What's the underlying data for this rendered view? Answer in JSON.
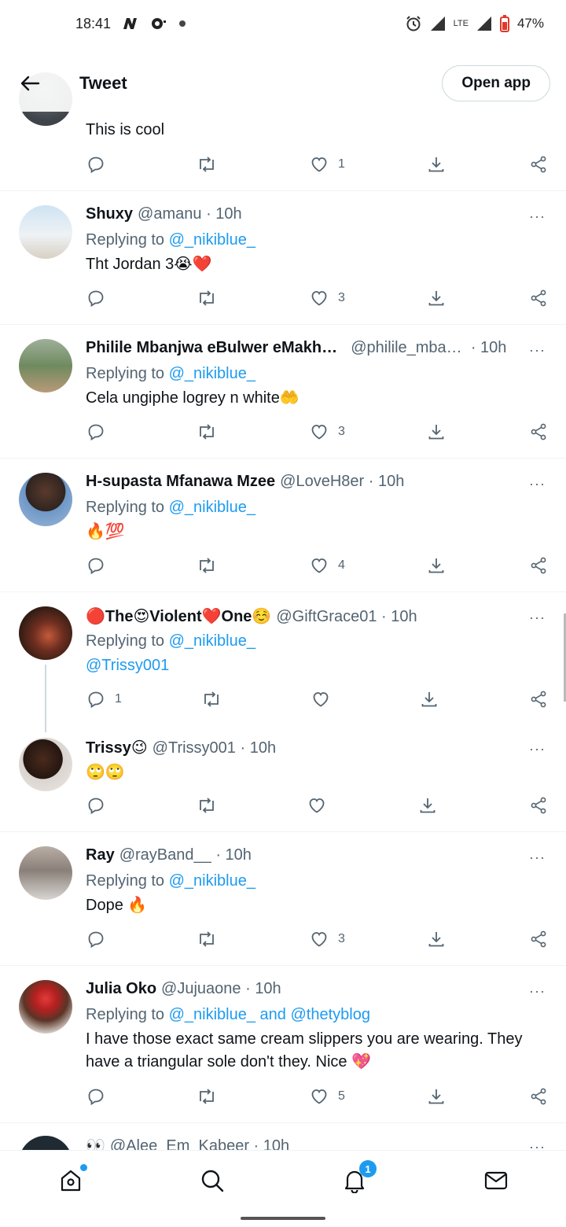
{
  "status": {
    "time": "18:41",
    "battery": "47%",
    "network": "LTE"
  },
  "header": {
    "title": "Tweet",
    "open_app": "Open app"
  },
  "tweets": [
    {
      "text": "This is cool",
      "likes": "1"
    },
    {
      "name": "Shuxy",
      "handle": "@amanu",
      "dot": "·",
      "time": "10h",
      "replying": "Replying to",
      "mention": "@_nikiblue_",
      "text": "Tht Jordan 3😭❤️",
      "likes": "3"
    },
    {
      "name": "Philile Mbanjwa eBulwer eMakh…",
      "handle": "@philile_mba…",
      "dot": "·",
      "time": "10h",
      "replying": "Replying to",
      "mention": "@_nikiblue_",
      "text": "Cela ungiphe logrey n white🤲",
      "likes": "3"
    },
    {
      "name": "H-supasta Mfanawa Mzee",
      "handle": "@LoveH8er",
      "dot": "·",
      "time": "10h",
      "replying": "Replying to",
      "mention": "@_nikiblue_",
      "text": "🔥💯",
      "likes": "4"
    },
    {
      "name": "🔴The😍Violent❤️One☺️",
      "handle": "@GiftGrace01",
      "dot": "·",
      "time": "10h",
      "replying": "Replying to",
      "mention": "@_nikiblue_",
      "text": "@Trissy001",
      "replies": "1"
    },
    {
      "name": "Trissy😉",
      "handle": "@Trissy001",
      "dot": "·",
      "time": "10h",
      "text": "🙄🙄"
    },
    {
      "name": "Ray",
      "handle": "@rayBand__",
      "dot": "·",
      "time": "10h",
      "replying": "Replying to",
      "mention": "@_nikiblue_",
      "text": "Dope 🔥",
      "likes": "3"
    },
    {
      "name": "Julia Oko",
      "handle": "@Jujuaone",
      "dot": "·",
      "time": "10h",
      "replying": "Replying to",
      "mention": "@_nikiblue_ and @thetyblog",
      "text": "I have those exact same cream slippers you are wearing. They have a triangular sole don't they. Nice 💖",
      "likes": "5"
    },
    {
      "name": "👀",
      "handle": "@Alee_Em_Kabeer",
      "dot": "·",
      "time": "10h"
    }
  ],
  "more_icon": "···",
  "nav": {
    "notifications_badge": "1"
  }
}
